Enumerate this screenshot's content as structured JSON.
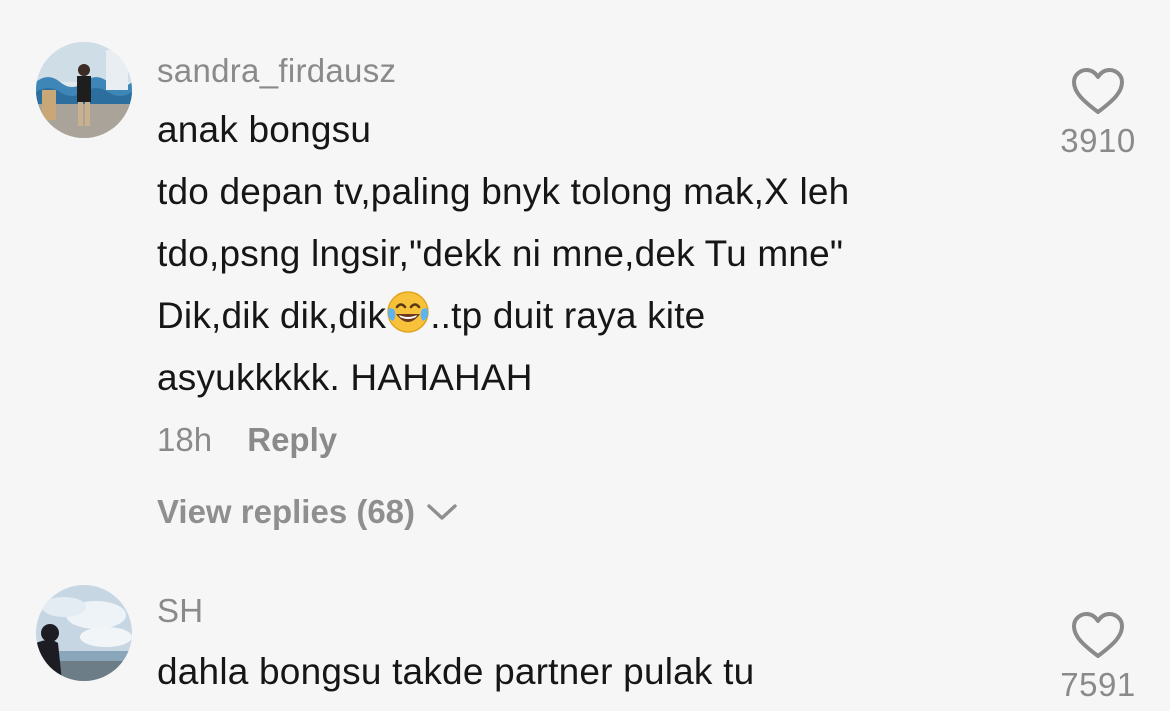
{
  "comments": [
    {
      "username": "sandra_firdausz",
      "text_lines": [
        "anak bongsu",
        "tdo depan tv,paling bnyk tolong mak,X leh",
        "tdo,psng lngsir,\"dekk ni mne,dek Tu mne\"",
        "Dik,dik dik,dik",
        "..tp duit raya kite",
        "asyukkkkk. HAHAHAH"
      ],
      "emoji": "face-with-tears-of-joy",
      "time": "18h",
      "reply_label": "Reply",
      "view_replies_label": "View replies (68)",
      "like_count": "3910"
    },
    {
      "username": "SH",
      "text_lines": [
        "dahla bongsu takde partner pulak tu"
      ],
      "like_count": "7591"
    }
  ],
  "icons": {
    "heart": "heart-outline-icon",
    "chevron": "chevron-down-icon",
    "emoji": "face-with-tears-of-joy-icon"
  },
  "colors": {
    "background": "#f6f6f6",
    "text": "#161616",
    "muted": "#8a8a8a"
  }
}
